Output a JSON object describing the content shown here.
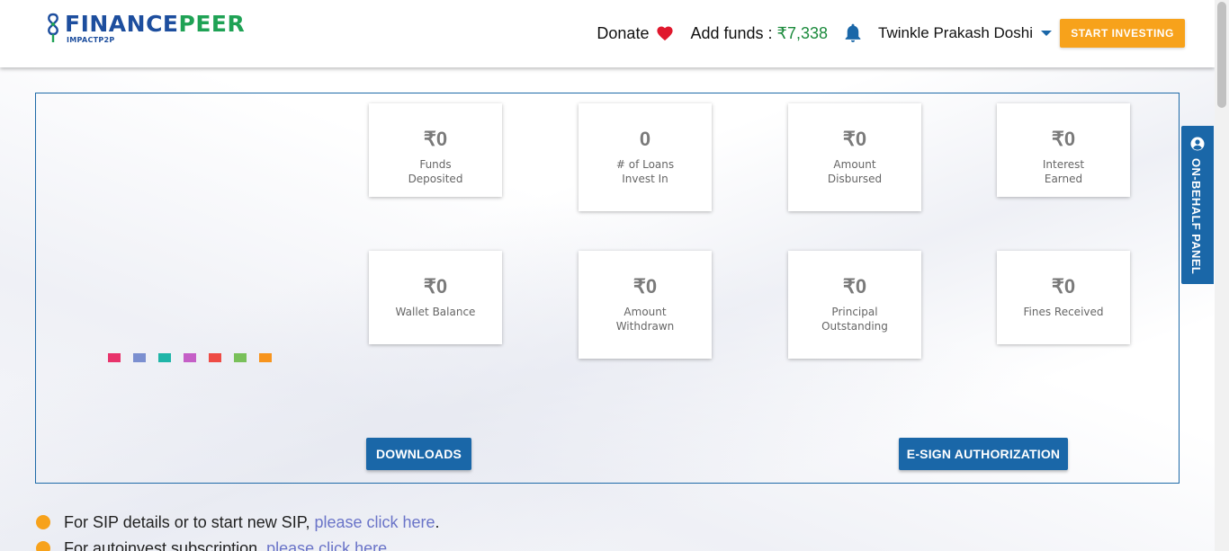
{
  "header": {
    "logo": {
      "brand_part1": "FINANCE",
      "brand_part2": "PEER",
      "sub": "IMPACTP2P"
    },
    "donate_label": "Donate",
    "add_funds_label": "Add funds : ",
    "add_funds_amount": "₹7,338",
    "user_name": "Twinkle Prakash Doshi",
    "start_investing_label": "START INVESTING"
  },
  "colors": {
    "primary_blue": "#1a67a8",
    "accent_orange": "#f7a21b",
    "funds_green": "#1b8a3c",
    "heart_red": "#e0182d",
    "link_purple": "#6a74c8"
  },
  "legend_dots": [
    "#e8336b",
    "#7b8fd0",
    "#1fb5a8",
    "#c55fc7",
    "#ee4b45",
    "#79c05a",
    "#f7941d"
  ],
  "stats": [
    {
      "value": "₹0",
      "label": "Funds Deposited"
    },
    {
      "value": "0",
      "label": "# of Loans Invest In"
    },
    {
      "value": "₹0",
      "label": "Amount Disbursed"
    },
    {
      "value": "₹0",
      "label": "Interest Earned"
    },
    {
      "value": "₹0",
      "label": "Wallet Balance"
    },
    {
      "value": "₹0",
      "label": "Amount Withdrawn"
    },
    {
      "value": "₹0",
      "label": "Principal Outstanding"
    },
    {
      "value": "₹0",
      "label": "Fines Received"
    }
  ],
  "buttons": {
    "downloads": "DOWNLOADS",
    "esign": "E-SIGN AUTHORIZATION"
  },
  "side_tab": {
    "label": "ON-BEHALF PANEL",
    "icon": "user-circle-icon"
  },
  "info_list": [
    {
      "text": "For SIP details or to start new SIP, ",
      "link": "please click here",
      "suffix": "."
    },
    {
      "text": "For autoinvest subscription, ",
      "link": "please click here",
      "suffix": ""
    }
  ]
}
